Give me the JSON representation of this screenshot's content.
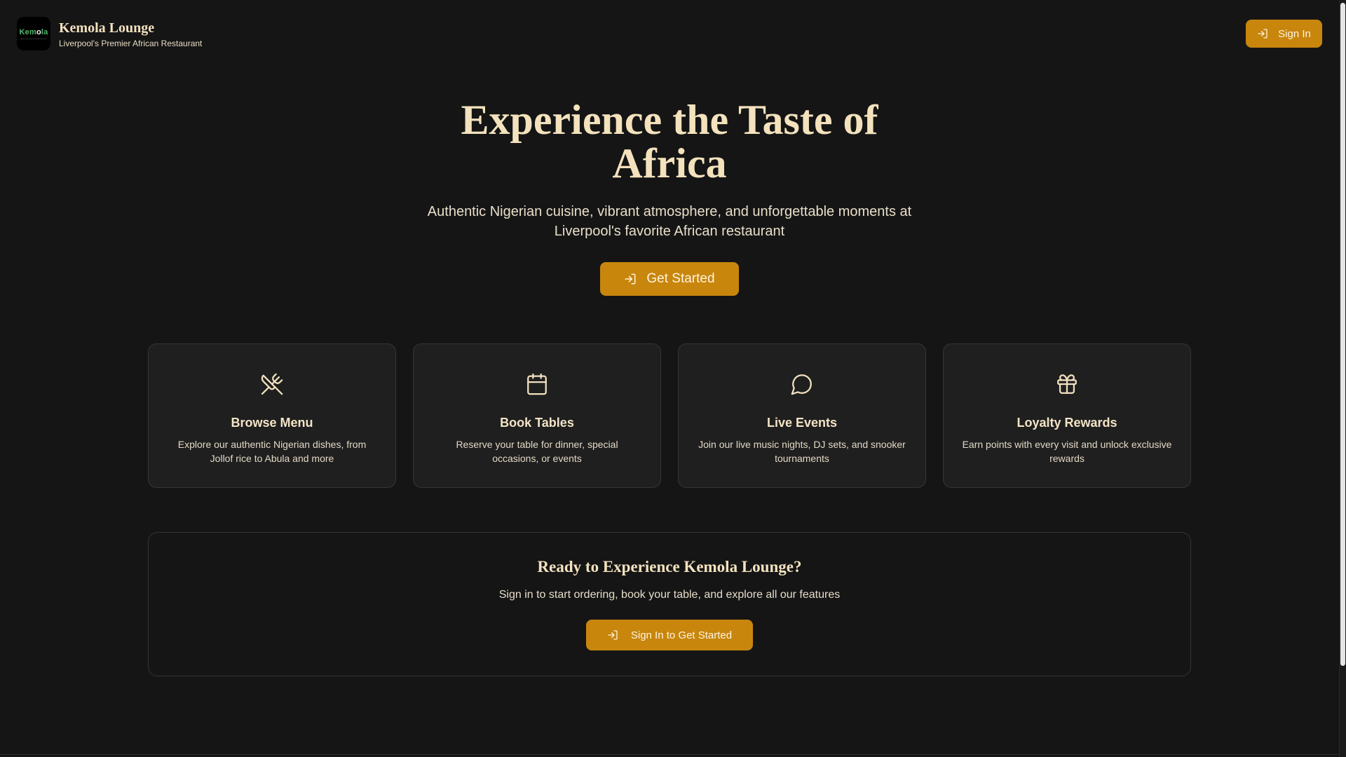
{
  "header": {
    "logo_text_a": "Kem",
    "logo_text_o": "o",
    "logo_text_b": "la",
    "brand_title": "Kemola Lounge",
    "brand_subtitle": "Liverpool's Premier African Restaurant",
    "signin_label": "Sign In"
  },
  "hero": {
    "title": "Experience the Taste of Africa",
    "subtitle": "Authentic Nigerian cuisine, vibrant atmosphere, and unforgettable moments at Liverpool's favorite African restaurant",
    "cta_label": "Get Started"
  },
  "features": [
    {
      "icon": "utensils-crossed-icon",
      "title": "Browse Menu",
      "description": "Explore our authentic Nigerian dishes, from Jollof rice to Abula and more"
    },
    {
      "icon": "calendar-icon",
      "title": "Book Tables",
      "description": "Reserve your table for dinner, special occasions, or events"
    },
    {
      "icon": "message-circle-icon",
      "title": "Live Events",
      "description": "Join our live music nights, DJ sets, and snooker tournaments"
    },
    {
      "icon": "gift-icon",
      "title": "Loyalty Rewards",
      "description": "Earn points with every visit and unlock exclusive rewards"
    }
  ],
  "cta": {
    "title": "Ready to Experience Kemola Lounge?",
    "subtitle": "Sign in to start ordering, book your table, and explore all our features",
    "button_label": "Sign In to Get Started"
  },
  "colors": {
    "background": "#151515",
    "card": "#1f1f1f",
    "accent": "#c8860d",
    "heading": "#f4e2bd"
  }
}
